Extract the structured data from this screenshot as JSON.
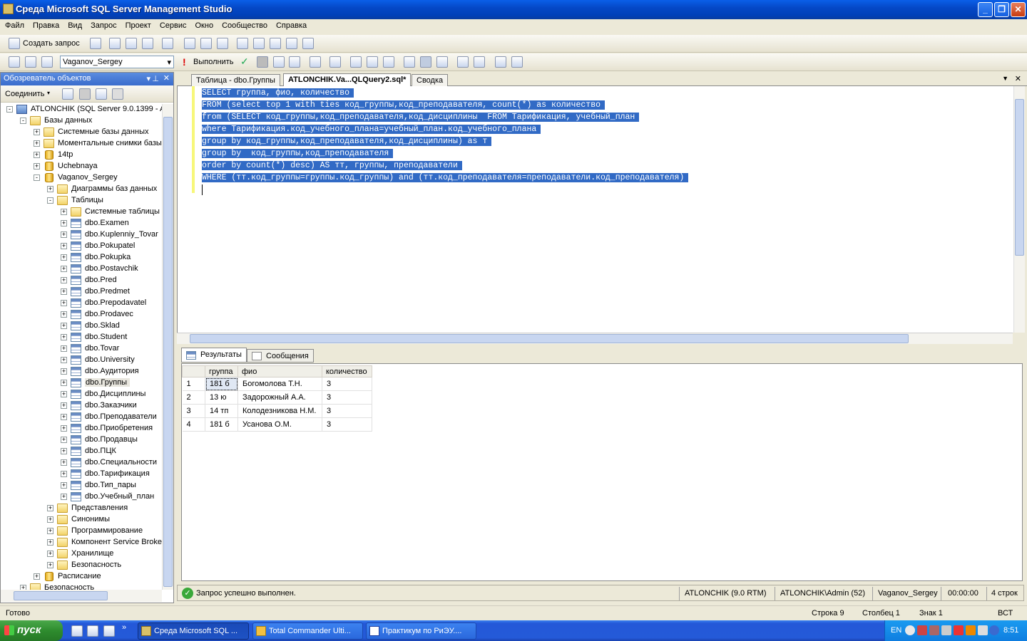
{
  "window": {
    "title": "Среда Microsoft SQL Server Management Studio"
  },
  "menu": [
    "Файл",
    "Правка",
    "Вид",
    "Запрос",
    "Проект",
    "Сервис",
    "Окно",
    "Сообщество",
    "Справка"
  ],
  "toolbar1": {
    "new_query": "Создать запрос"
  },
  "toolbar2": {
    "database": "Vaganov_Sergey",
    "execute": "Выполнить"
  },
  "object_explorer": {
    "title": "Обозреватель объектов",
    "connect": "Соединить",
    "tree": [
      {
        "level": 0,
        "exp": "-",
        "icon": "server",
        "label": "ATLONCHIK (SQL Server 9.0.1399 - A"
      },
      {
        "level": 1,
        "exp": "-",
        "icon": "folder",
        "label": "Базы данных"
      },
      {
        "level": 2,
        "exp": "+",
        "icon": "folder",
        "label": "Системные базы данных"
      },
      {
        "level": 2,
        "exp": "+",
        "icon": "folder",
        "label": "Моментальные снимки базы"
      },
      {
        "level": 2,
        "exp": "+",
        "icon": "db",
        "label": "14tp"
      },
      {
        "level": 2,
        "exp": "+",
        "icon": "db",
        "label": "Uchebnaya"
      },
      {
        "level": 2,
        "exp": "-",
        "icon": "db",
        "label": "Vaganov_Sergey"
      },
      {
        "level": 3,
        "exp": "+",
        "icon": "folder",
        "label": "Диаграммы баз данных"
      },
      {
        "level": 3,
        "exp": "-",
        "icon": "folder",
        "label": "Таблицы"
      },
      {
        "level": 4,
        "exp": "+",
        "icon": "folder",
        "label": "Системные таблицы"
      },
      {
        "level": 4,
        "exp": "+",
        "icon": "table",
        "label": "dbo.Examen"
      },
      {
        "level": 4,
        "exp": "+",
        "icon": "table",
        "label": "dbo.Kuplenniy_Tovar"
      },
      {
        "level": 4,
        "exp": "+",
        "icon": "table",
        "label": "dbo.Pokupatel"
      },
      {
        "level": 4,
        "exp": "+",
        "icon": "table",
        "label": "dbo.Pokupka"
      },
      {
        "level": 4,
        "exp": "+",
        "icon": "table",
        "label": "dbo.Postavchik"
      },
      {
        "level": 4,
        "exp": "+",
        "icon": "table",
        "label": "dbo.Pred"
      },
      {
        "level": 4,
        "exp": "+",
        "icon": "table",
        "label": "dbo.Predmet"
      },
      {
        "level": 4,
        "exp": "+",
        "icon": "table",
        "label": "dbo.Prepodavatel"
      },
      {
        "level": 4,
        "exp": "+",
        "icon": "table",
        "label": "dbo.Prodavec"
      },
      {
        "level": 4,
        "exp": "+",
        "icon": "table",
        "label": "dbo.Sklad"
      },
      {
        "level": 4,
        "exp": "+",
        "icon": "table",
        "label": "dbo.Student"
      },
      {
        "level": 4,
        "exp": "+",
        "icon": "table",
        "label": "dbo.Tovar"
      },
      {
        "level": 4,
        "exp": "+",
        "icon": "table",
        "label": "dbo.University"
      },
      {
        "level": 4,
        "exp": "+",
        "icon": "table",
        "label": "dbo.Аудитория"
      },
      {
        "level": 4,
        "exp": "+",
        "icon": "table",
        "label": "dbo.Группы",
        "selected": true
      },
      {
        "level": 4,
        "exp": "+",
        "icon": "table",
        "label": "dbo.Дисциплины"
      },
      {
        "level": 4,
        "exp": "+",
        "icon": "table",
        "label": "dbo.Заказчики"
      },
      {
        "level": 4,
        "exp": "+",
        "icon": "table",
        "label": "dbo.Преподаватели"
      },
      {
        "level": 4,
        "exp": "+",
        "icon": "table",
        "label": "dbo.Приобретения"
      },
      {
        "level": 4,
        "exp": "+",
        "icon": "table",
        "label": "dbo.Продавцы"
      },
      {
        "level": 4,
        "exp": "+",
        "icon": "table",
        "label": "dbo.ПЦК"
      },
      {
        "level": 4,
        "exp": "+",
        "icon": "table",
        "label": "dbo.Специальности"
      },
      {
        "level": 4,
        "exp": "+",
        "icon": "table",
        "label": "dbo.Тарификация"
      },
      {
        "level": 4,
        "exp": "+",
        "icon": "table",
        "label": "dbo.Тип_пары"
      },
      {
        "level": 4,
        "exp": "+",
        "icon": "table",
        "label": "dbo.Учебный_план"
      },
      {
        "level": 3,
        "exp": "+",
        "icon": "folder",
        "label": "Представления"
      },
      {
        "level": 3,
        "exp": "+",
        "icon": "folder",
        "label": "Синонимы"
      },
      {
        "level": 3,
        "exp": "+",
        "icon": "folder",
        "label": "Программирование"
      },
      {
        "level": 3,
        "exp": "+",
        "icon": "folder",
        "label": "Компонент Service Broke"
      },
      {
        "level": 3,
        "exp": "+",
        "icon": "folder",
        "label": "Хранилище"
      },
      {
        "level": 3,
        "exp": "+",
        "icon": "folder",
        "label": "Безопасность"
      },
      {
        "level": 2,
        "exp": "+",
        "icon": "db",
        "label": "Расписание"
      },
      {
        "level": 1,
        "exp": "+",
        "icon": "folder",
        "label": "Безопасность"
      }
    ]
  },
  "doc_tabs": [
    "Таблица - dbo.Группы",
    "ATLONCHIK.Va...QLQuery2.sql*",
    "Сводка"
  ],
  "editor": {
    "lines": [
      "SELECT группа, фио, количество",
      "FROM (select top 1 with ties код_группы,код_преподавателя, count(*) as количество",
      "from (SELECT код_группы,код_преподавателя,код_дисциплины  FROM Тарификация, учебный_план",
      "where Тарификация.код_учебного_плана=учебный_план.код_учебного_плана",
      "group by код_группы,код_преподавателя,код_дисциплины) as т",
      "group by  код_группы,код_преподавателя",
      "order by count(*) desc) AS тт, группы, преподаватели",
      "WHERE (тт.код_группы=группы.код_группы) and (тт.код_преподавателя=преподаватели.код_преподавателя)"
    ]
  },
  "results": {
    "tabs": [
      "Результаты",
      "Сообщения"
    ],
    "columns": [
      "группа",
      "фио",
      "количество"
    ],
    "rows": [
      {
        "n": "1",
        "c": [
          "181 б",
          "Богомолова Т.Н.",
          "3"
        ]
      },
      {
        "n": "2",
        "c": [
          "13 ю",
          "Задорожный А.А.",
          "3"
        ]
      },
      {
        "n": "3",
        "c": [
          "14 тп",
          "Колодезникова Н.М.",
          "3"
        ]
      },
      {
        "n": "4",
        "c": [
          "181 б",
          "Усанова О.М.",
          "3"
        ]
      }
    ]
  },
  "query_status": {
    "message": "Запрос успешно выполнен.",
    "server": "ATLONCHIK (9.0 RTM)",
    "user": "ATLONCHIK\\Admin (52)",
    "database": "Vaganov_Sergey",
    "time": "00:00:00",
    "rows": "4 строк"
  },
  "status_bar": {
    "ready": "Готово",
    "line": "Строка 9",
    "col": "Столбец 1",
    "ch": "Знак 1",
    "ins": "ВСТ"
  },
  "taskbar": {
    "start": "пуск",
    "tasks": [
      "Среда Microsoft SQL ...",
      "Total Commander Ulti...",
      "Практикум по РиЭУ...."
    ],
    "lang": "EN",
    "clock": "8:51"
  }
}
